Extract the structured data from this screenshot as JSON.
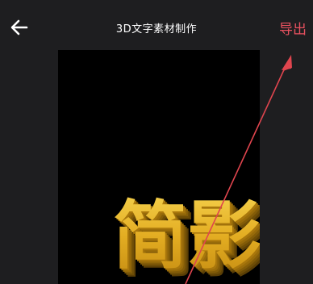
{
  "header": {
    "title": "3D文字素材制作",
    "export_label": "导出"
  },
  "preview": {
    "text": "简影",
    "text_color": "#e6b52a",
    "extrude_color": "#8a6208",
    "background": "#000000"
  },
  "annotation": {
    "arrow_color": "#e0454e"
  },
  "colors": {
    "background": "#1e1e20",
    "accent": "#e8515f"
  }
}
